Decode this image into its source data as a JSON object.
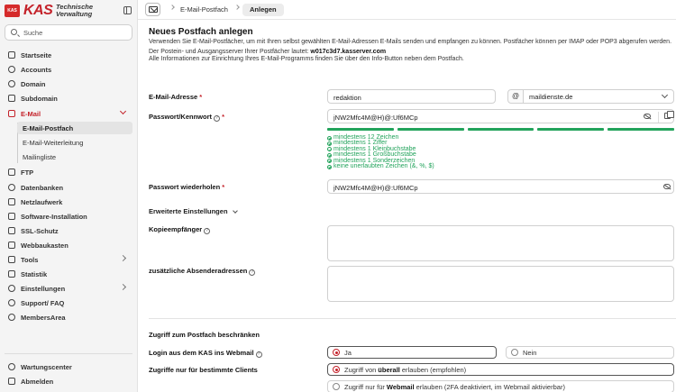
{
  "sidebar": {
    "logo_mark": "KAS",
    "logo_title": "KAS",
    "logo_subtitle": "Technische Verwaltung",
    "search_placeholder": "Suche",
    "items": [
      {
        "label": "Startseite"
      },
      {
        "label": "Accounts"
      },
      {
        "label": "Domain"
      },
      {
        "label": "Subdomain"
      },
      {
        "label": "E-Mail"
      },
      {
        "label": "FTP"
      },
      {
        "label": "Datenbanken"
      },
      {
        "label": "Netzlaufwerk"
      },
      {
        "label": "Software-Installation"
      },
      {
        "label": "SSL-Schutz"
      },
      {
        "label": "Webbaukasten"
      },
      {
        "label": "Tools"
      },
      {
        "label": "Statistik"
      },
      {
        "label": "Einstellungen"
      },
      {
        "label": "Support/ FAQ"
      },
      {
        "label": "MembersArea"
      }
    ],
    "email_sub": [
      {
        "label": "E-Mail-Postfach"
      },
      {
        "label": "E-Mail-Weiterleitung"
      },
      {
        "label": "Mailingliste"
      }
    ],
    "bottom": [
      {
        "label": "Wartungscenter"
      },
      {
        "label": "Abmelden"
      }
    ]
  },
  "breadcrumb": {
    "item1": "E-Mail-Postfach",
    "item2": "Anlegen"
  },
  "form": {
    "title": "Neues Postfach anlegen",
    "intro1": "Verwenden Sie E-Mail-Postfächer, um mit Ihren selbst gewählten E-Mail-Adressen E-Mails senden und empfangen zu können. Postfächer können per IMAP oder POP3 abgerufen werden.",
    "intro2_prefix": "Der Postein- und Ausgangsserver Ihrer Postfächer lautet:",
    "intro2_server": "w017c3d7.kasserver.com",
    "intro3": "Alle Informationen zur Einrichtung Ihres E-Mail-Programms finden Sie über den Info-Button neben dem Postfach.",
    "email_label": "E-Mail-Adresse",
    "email_value": "redaktion",
    "at": "@",
    "domain_value": "maildienste.de",
    "password_label": "Passwort/Kennwort",
    "password_value": "jNW2Mfc4M@H)@:Uf6MCp",
    "password_strength": 1.0,
    "rules": [
      "mindestens 12 Zeichen",
      "mindestens 1 Ziffer",
      "mindestens 1 Kleinbuchstabe",
      "mindestens 1 Großbuchstabe",
      "mindestens 1 Sonderzeichen",
      "keine unerlaubten Zeichen (&, %, $)"
    ],
    "password_repeat_label": "Passwort wiederholen",
    "password_repeat_value": "jNW2Mfc4M@H)@:Uf6MCp",
    "advanced_label": "Erweiterte Einstellungen",
    "copy_label": "Kopieempfänger",
    "sender_label": "zusätzliche Absenderadressen",
    "access_title": "Zugriff zum Postfach beschränken",
    "webmail_label": "Login aus dem KAS ins Webmail",
    "webmail_yes": "Ja",
    "webmail_no": "Nein",
    "clients_label": "Zugriffe nur für bestimmte Clients",
    "clients_opt1_pre": "Zugriff von",
    "clients_opt1_bold": "überall",
    "clients_opt1_post": "erlauben (empfohlen)",
    "clients_opt2_pre": "Zugriff nur für",
    "clients_opt2_bold": "Webmail",
    "clients_opt2_post": "erlauben (2FA deaktiviert, im Webmail aktivierbar)"
  },
  "colors": {
    "brand": "#c4222a",
    "success": "#22a35b"
  }
}
